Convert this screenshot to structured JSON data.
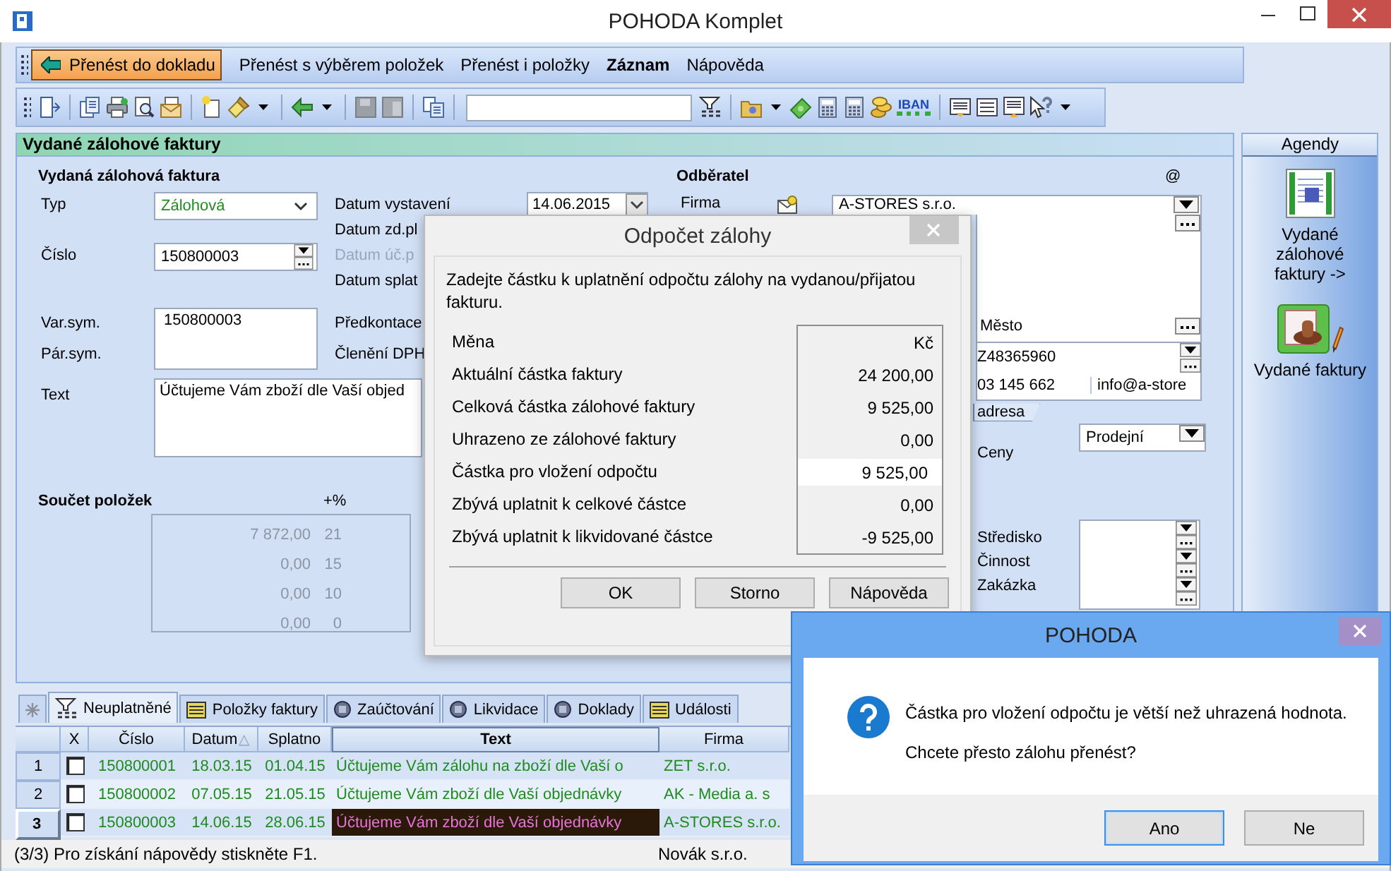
{
  "window": {
    "title": "POHODA Komplet"
  },
  "menu": [
    {
      "label": "Přenést do dokladu",
      "kind": "primary"
    },
    {
      "label": "Přenést s výběrem položek",
      "kind": "plain"
    },
    {
      "label": "Přenést i položky",
      "kind": "plain"
    },
    {
      "label": "Záznam",
      "kind": "bold"
    },
    {
      "label": "Nápověda",
      "kind": "plain"
    }
  ],
  "toolbar": {
    "iban_label": "IBAN"
  },
  "record_panel": {
    "title": "Vydané zálohové faktury",
    "section": "Vydaná zálohová faktura",
    "typ": {
      "label": "Typ",
      "value": "Zálohová"
    },
    "cislo": {
      "label": "Číslo",
      "value": "150800003"
    },
    "dates": [
      {
        "label": "Datum vystavení",
        "value": "14.06.2015",
        "disabled": false
      },
      {
        "label": "Datum zd.pl",
        "disabled": false
      },
      {
        "label": "Datum úč.p",
        "disabled": true
      },
      {
        "label": "Datum splat",
        "disabled": false
      }
    ],
    "var_sym": {
      "label": "Var.sym.",
      "value": "150800003"
    },
    "par_sym": {
      "label": "Pár.sym."
    },
    "accounting": [
      {
        "label": "Předkontace"
      },
      {
        "label": "Členění DPH"
      }
    ],
    "text": {
      "label": "Text",
      "value": "Účtujeme Vám zboží dle Vaší objed"
    },
    "totals": {
      "label": "Součet položek",
      "rate_label": "+%",
      "rows": [
        {
          "amount": "7 872,00",
          "rate": "21"
        },
        {
          "amount": "0,00",
          "rate": "15"
        },
        {
          "amount": "0,00",
          "rate": "10"
        },
        {
          "amount": "0,00",
          "rate": "0"
        }
      ]
    }
  },
  "customer": {
    "title": "Odběratel",
    "email_mark": "@",
    "firma_label": "Firma",
    "firma": "A-STORES s.r.o.",
    "city_label": "Město",
    "ico": "Z48365960",
    "phone": "03 145 662",
    "email": "info@a-store",
    "address_tab": "adresa",
    "price_label": "Ceny",
    "price": "Prodejní",
    "fields": [
      "Středisko",
      "Činnost",
      "Zakázka"
    ]
  },
  "agendas": {
    "title": "Agendy",
    "items": [
      {
        "label": "Vydané zálohové faktury ->",
        "kind": "advance"
      },
      {
        "label": "Vydané faktury",
        "kind": "invoice"
      }
    ]
  },
  "tabs": [
    {
      "kind": "star",
      "selected": false
    },
    {
      "label": "Neuplatněné",
      "kind": "filter",
      "selected": true
    },
    {
      "label": "Položky faktury",
      "kind": "list",
      "selected": false
    },
    {
      "label": "Zaúčtování",
      "kind": "disc",
      "selected": false
    },
    {
      "label": "Likvidace",
      "kind": "disc",
      "selected": false
    },
    {
      "label": "Doklady",
      "kind": "disc",
      "selected": false
    },
    {
      "label": "Události",
      "kind": "list",
      "selected": false
    }
  ],
  "table": {
    "check_column": {
      "label": "X"
    },
    "columns": [
      {
        "label": "Číslo",
        "active": false
      },
      {
        "label": "Datum",
        "active": false,
        "sort_mark": "△"
      },
      {
        "label": "Splatno",
        "active": false
      },
      {
        "label": "Text",
        "active": true
      },
      {
        "label": "Firma",
        "active": false
      }
    ],
    "rows": [
      {
        "number": "1",
        "checked": false,
        "selected": false,
        "cells": [
          "150800001",
          "18.03.15",
          "01.04.15",
          "Účtujeme Vám zálohu na zboží dle Vaší o",
          "ZET s.r.o."
        ]
      },
      {
        "number": "2",
        "checked": false,
        "selected": false,
        "cells": [
          "150800002",
          "07.05.15",
          "21.05.15",
          "Účtujeme Vám zboží dle Vaší objednávky",
          "AK - Media a. s"
        ]
      },
      {
        "number": "3",
        "checked": false,
        "selected": true,
        "cells": [
          "150800003",
          "14.06.15",
          "28.06.15",
          "Účtujeme Vám zboží dle Vaší objednávky",
          "A-STORES s.r.o."
        ]
      }
    ]
  },
  "status_bar": {
    "message": "(3/3) Pro získání nápovědy stiskněte F1.",
    "company": "Novák s.r.o."
  },
  "deduction_dialog": {
    "title": "Odpočet zálohy",
    "prompt": "Zadejte částku k uplatnění odpočtu zálohy na vydanou/přijatou fakturu.",
    "rows": [
      {
        "label": "Měna",
        "value": "Kč",
        "kind": "text"
      },
      {
        "label": "Aktuální částka faktury",
        "value": "24 200,00",
        "kind": "text"
      },
      {
        "label": "Celková částka zálohové faktury",
        "value": "9 525,00",
        "kind": "text"
      },
      {
        "label": "Uhrazeno ze zálohové faktury",
        "value": "0,00",
        "kind": "text"
      },
      {
        "label": "Částka pro vložení odpočtu",
        "value": "9 525,00",
        "kind": "input"
      },
      {
        "label": "Zbývá uplatnit k celkové částce",
        "value": "0,00",
        "kind": "text"
      },
      {
        "label": "Zbývá uplatnit k likvidované částce",
        "value": "-9 525,00",
        "kind": "text"
      }
    ],
    "buttons": [
      "OK",
      "Storno",
      "Nápověda"
    ]
  },
  "message_box": {
    "title": "POHODA",
    "lines": [
      "Částka pro vložení odpočtu je větší než uhrazená hodnota.",
      "Chcete přesto zálohu přenést?"
    ],
    "buttons": [
      {
        "label": "Ano",
        "default": true
      },
      {
        "label": "Ne",
        "default": false
      }
    ]
  }
}
